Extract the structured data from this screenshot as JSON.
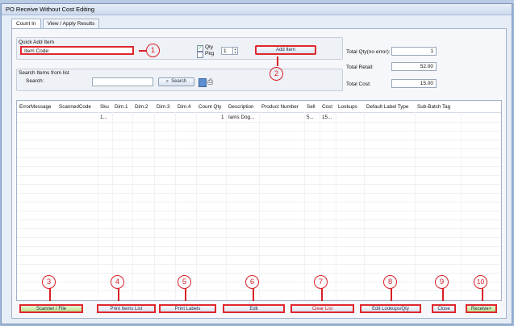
{
  "window": {
    "title": "PO Receive Without Cost Editing"
  },
  "tabs": [
    {
      "label": "Count In"
    },
    {
      "label": "View / Apply Results"
    }
  ],
  "quick_add": {
    "group_label": "Quick Add Item",
    "item_code_label": "Item Code:",
    "qty_label": "Qty",
    "pkg_label": "Pkg",
    "qty_value": "1",
    "add_button": "Add Item"
  },
  "search": {
    "group_label": "Search Items from list",
    "search_label": "Search:",
    "search_button": "Search"
  },
  "totals": {
    "qty_label": "Total Qty(no error):",
    "qty_value": "1",
    "retail_label": "Total Retail:",
    "retail_value": "52.00",
    "cost_label": "Total Cost:",
    "cost_value": "15.00"
  },
  "grid": {
    "columns": [
      "ErrorMessage",
      "ScannedCode",
      "Sku",
      "Dim.1",
      "Dim.2",
      "Dim.3",
      "Dim.4",
      "Count Qty",
      "Description",
      "Product Number",
      "Sell",
      "Cost",
      "Lookups",
      "Default Label Type",
      "Sub-Batch Tag"
    ],
    "rows": [
      [
        "",
        "",
        "1...",
        "",
        "",
        "",
        "",
        "1",
        "Iams Dog...",
        "",
        "5...",
        "15...",
        "",
        "",
        ""
      ]
    ]
  },
  "buttons": {
    "scanner": "Scanner / File",
    "print_items": "Print Items List",
    "print_labels": "Print Labels",
    "edit": "Edit",
    "clear": "Clear List",
    "edit_lookups": "Edit Lookups/Qty",
    "close": "Close",
    "receive": "Receive>"
  },
  "callouts": [
    "1",
    "2",
    "3",
    "4",
    "5",
    "6",
    "7",
    "8",
    "9",
    "10"
  ],
  "colors": {
    "annotation": "#e0262d",
    "window_bg": "#e6edf6"
  }
}
